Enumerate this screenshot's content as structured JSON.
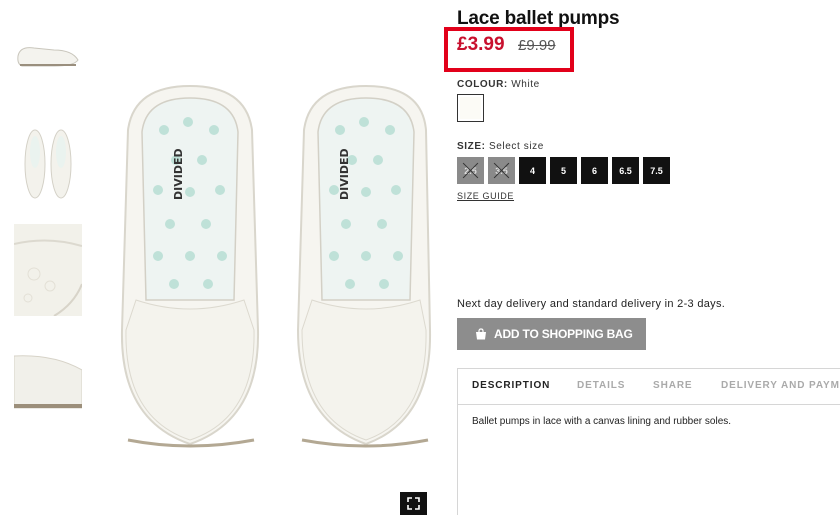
{
  "product": {
    "title": "Lace ballet pumps",
    "price_now": "£3.99",
    "price_old": "£9.99",
    "colour_label": "COLOUR:",
    "colour_value": "White",
    "size_label": "SIZE:",
    "size_prompt": "Select size",
    "sizes": [
      {
        "label": "2.5",
        "available": false
      },
      {
        "label": "3.5",
        "available": false
      },
      {
        "label": "4",
        "available": true
      },
      {
        "label": "5",
        "available": true
      },
      {
        "label": "6",
        "available": true
      },
      {
        "label": "6.5",
        "available": true
      },
      {
        "label": "7.5",
        "available": true
      }
    ],
    "size_guide": "SIZE GUIDE",
    "delivery": "Next day delivery and standard delivery in 2-3 days.",
    "add_to_bag": "ADD TO SHOPPING BAG",
    "tabs": [
      "DESCRIPTION",
      "DETAILS",
      "SHARE",
      "DELIVERY AND PAYMENT"
    ],
    "description": "Ballet pumps in lace with a canvas lining and rubber soles.",
    "insole_brand": "DIVIDED"
  },
  "gallery": {
    "thumbnails": [
      "side-view",
      "top-view-pair",
      "toe-detail",
      "heel-detail"
    ],
    "expand_icon": "expand-icon",
    "bag_icon": "shopping-bag-icon"
  },
  "colors": {
    "price_red": "#c8102e",
    "highlight_border": "#e2001a",
    "size_available": "#111111",
    "size_unavailable": "#8a8a8a",
    "add_button": "#8d8d8d"
  }
}
